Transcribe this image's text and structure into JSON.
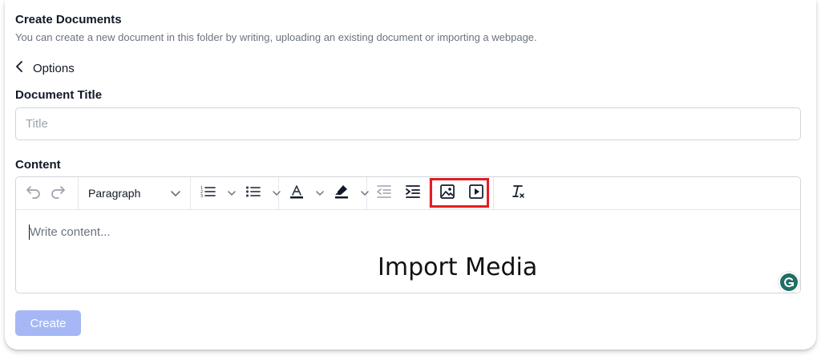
{
  "header": {
    "title": "Create Documents",
    "subtitle": "You can create a new document in this folder by writing, uploading an existing document or importing a webpage."
  },
  "options": {
    "label": "Options",
    "icon": "chevron-left-icon"
  },
  "document_title": {
    "label": "Document Title",
    "placeholder": "Title"
  },
  "content": {
    "label": "Content",
    "placeholder": "Write content...",
    "annotation": "Import Media"
  },
  "toolbar": {
    "paragraph_label": "Paragraph",
    "icons": [
      "undo-icon",
      "redo-icon",
      "chevron-down-icon",
      "ordered-list-icon",
      "bullet-list-icon",
      "text-color-icon",
      "highlight-icon",
      "outdent-icon",
      "indent-icon",
      "image-icon",
      "video-icon",
      "clear-format-icon"
    ],
    "highlight_color": "#e11d23"
  },
  "create_button": {
    "label": "Create",
    "color": "#a5b8f5"
  },
  "grammarly": {
    "color": "#1f6f64"
  }
}
